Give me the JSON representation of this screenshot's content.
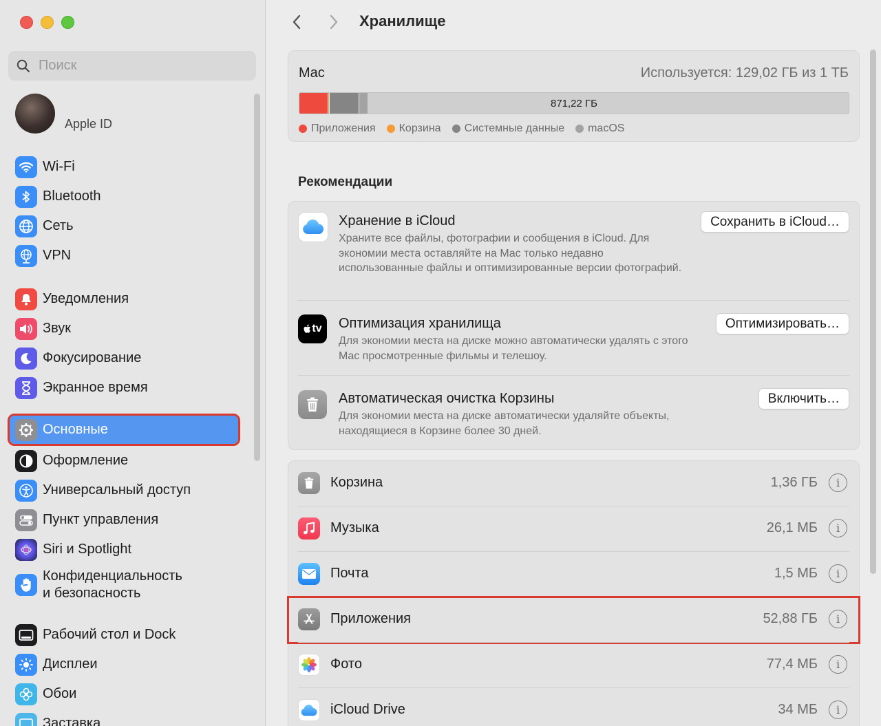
{
  "sidebar": {
    "search_placeholder": "Поиск",
    "apple_id_label": "Apple ID",
    "items": [
      {
        "label": "Wi-Fi",
        "icon": "wifi-icon",
        "color": "#3a8ef6"
      },
      {
        "label": "Bluetooth",
        "icon": "bluetooth-icon",
        "color": "#3a8ef6"
      },
      {
        "label": "Сеть",
        "icon": "globe-icon",
        "color": "#3a8ef6"
      },
      {
        "label": "VPN",
        "icon": "vpn-globe-icon",
        "color": "#3a8ef6"
      },
      {
        "label": "Уведомления",
        "icon": "bell-icon",
        "color": "#ef4b43"
      },
      {
        "label": "Звук",
        "icon": "speaker-icon",
        "color": "#ef4b6a"
      },
      {
        "label": "Фокусирование",
        "icon": "moon-icon",
        "color": "#5e5ce6"
      },
      {
        "label": "Экранное время",
        "icon": "hourglass-icon",
        "color": "#5e5ce6"
      },
      {
        "label": "Основные",
        "icon": "gear-icon",
        "color": "#8e8e93"
      },
      {
        "label": "Оформление",
        "icon": "appearance-icon",
        "color": "#1d1d1f"
      },
      {
        "label": "Универсальный доступ",
        "icon": "accessibility-icon",
        "color": "#3a8ef6"
      },
      {
        "label": "Пункт управления",
        "icon": "control-center-icon",
        "color": "#8e8e93"
      },
      {
        "label": "Siri и Spotlight",
        "icon": "siri-icon",
        "color": "#2b2b6b"
      },
      {
        "label_line1": "Конфиденциальность",
        "label_line2": "и безопасность",
        "icon": "hand-icon",
        "color": "#3a8ef6"
      },
      {
        "label": "Рабочий стол и Dock",
        "icon": "dock-icon",
        "color": "#1d1d1f"
      },
      {
        "label": "Дисплеи",
        "icon": "sun-icon",
        "color": "#3a8ef6"
      },
      {
        "label": "Обои",
        "icon": "flower-icon",
        "color": "#3fb5e8"
      },
      {
        "label": "Заставка",
        "icon": "screensaver-icon",
        "color": "#4fb7e8"
      }
    ]
  },
  "main": {
    "title": "Хранилище",
    "mac": {
      "label": "Mac",
      "usage": "Используется: 129,02 ГБ из 1 ТБ",
      "free_label": "871,22 ГБ",
      "segments": [
        {
          "name": "Приложения",
          "color": "#ee4a3e",
          "fraction": 0.052
        },
        {
          "name": "Корзина",
          "color": "#f59b38",
          "fraction": 0.002
        },
        {
          "name": "Системные данные",
          "color": "#858585",
          "fraction": 0.054
        },
        {
          "name": "macOS",
          "color": "#a3a3a3",
          "fraction": 0.016
        }
      ],
      "legend": [
        "Приложения",
        "Корзина",
        "Системные данные",
        "macOS"
      ]
    },
    "recommendations_title": "Рекомендации",
    "recommendations": [
      {
        "title": "Хранение в iCloud",
        "description": "Храните все файлы, фотографии и сообщения в iCloud. Для экономии места оставляйте на Mac только недавно использованные файлы и оптимизированные версии фотографий.",
        "button": "Сохранить в iCloud…"
      },
      {
        "title": "Оптимизация хранилища",
        "description": "Для экономии места на диске можно автоматически удалять с этого Mac просмотренные фильмы и телешоу.",
        "button": "Оптимизировать…",
        "icon_text": "tv"
      },
      {
        "title": "Автоматическая очистка Корзины",
        "description": "Для экономии места на диске автоматически удаляйте объекты, находящиеся в Корзине более 30 дней.",
        "button": "Включить…"
      }
    ],
    "categories": [
      {
        "label": "Корзина",
        "size": "1,36 ГБ"
      },
      {
        "label": "Музыка",
        "size": "26,1 МБ"
      },
      {
        "label": "Почта",
        "size": "1,5 МБ"
      },
      {
        "label": "Приложения",
        "size": "52,88 ГБ"
      },
      {
        "label": "Фото",
        "size": "77,4 МБ"
      },
      {
        "label": "iCloud Drive",
        "size": "34 МБ"
      }
    ],
    "info_glyph": "i"
  },
  "colors": {
    "selection": "#5596f0",
    "highlight_outline": "#d83a2f"
  }
}
